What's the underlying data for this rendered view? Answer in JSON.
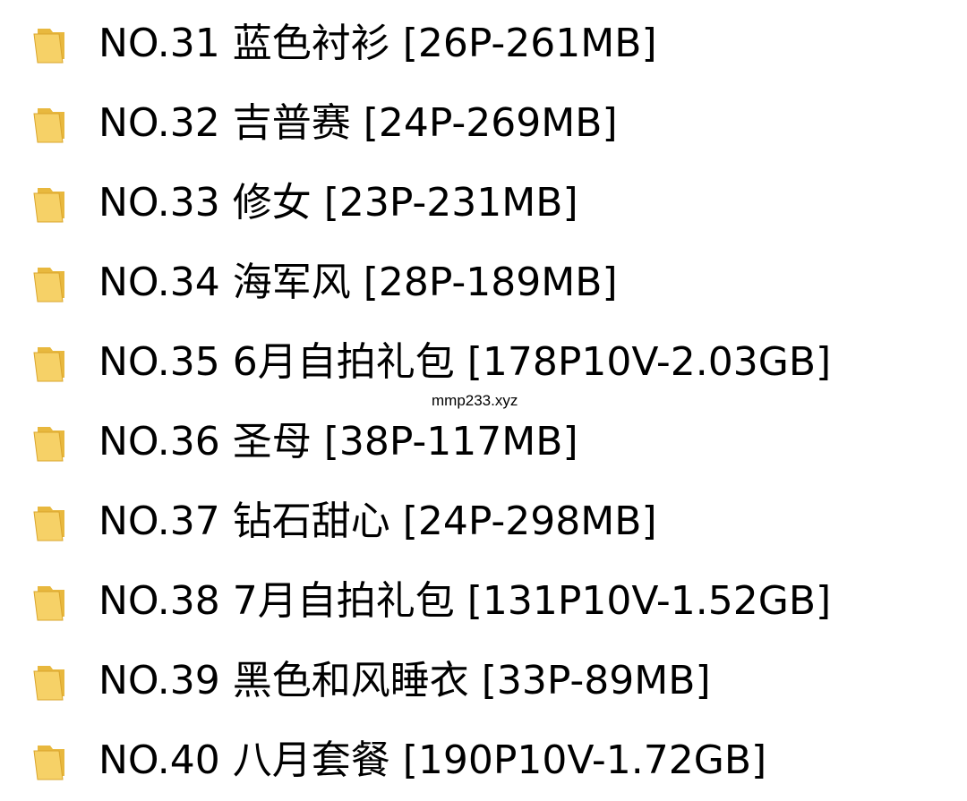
{
  "colors": {
    "background": "#ffffff",
    "text": "#000000",
    "folder_front": "#f6d167",
    "folder_back": "#e8b83e",
    "folder_edge": "#d9a52c"
  },
  "items": [
    {
      "icon": "folder-icon",
      "label": "NO.31 蓝色衬衫 [26P-261MB]"
    },
    {
      "icon": "folder-icon",
      "label": "NO.32 吉普赛 [24P-269MB]"
    },
    {
      "icon": "folder-icon",
      "label": "NO.33 修女 [23P-231MB]"
    },
    {
      "icon": "folder-icon",
      "label": "NO.34 海军风 [28P-189MB]"
    },
    {
      "icon": "folder-icon",
      "label": "NO.35 6月自拍礼包 [178P10V-2.03GB]"
    },
    {
      "icon": "folder-icon",
      "label": "NO.36 圣母 [38P-117MB]"
    },
    {
      "icon": "folder-icon",
      "label": "NO.37 钻石甜心 [24P-298MB]"
    },
    {
      "icon": "folder-icon",
      "label": "NO.38 7月自拍礼包 [131P10V-1.52GB]"
    },
    {
      "icon": "folder-icon",
      "label": "NO.39 黑色和风睡衣 [33P-89MB]"
    },
    {
      "icon": "folder-icon",
      "label": "NO.40 八月套餐 [190P10V-1.72GB]"
    }
  ],
  "watermark": "mmp233.xyz"
}
